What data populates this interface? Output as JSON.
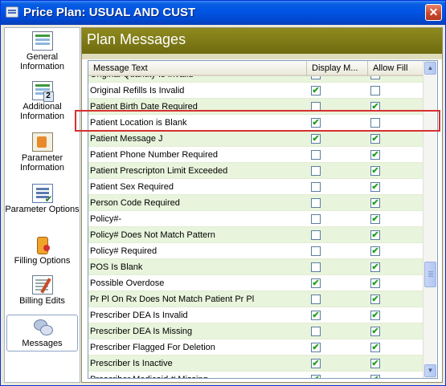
{
  "window": {
    "title": "Price Plan: USUAL AND CUST",
    "close_glyph": "✕"
  },
  "sidebar": {
    "items": [
      {
        "label": "General Information",
        "icon": "general-info-icon"
      },
      {
        "label": "Additional Information",
        "icon": "additional-info-icon"
      },
      {
        "label": "Parameter Information",
        "icon": "parameter-info-icon"
      },
      {
        "label": "Parameter Options",
        "icon": "parameter-options-icon"
      },
      {
        "label": "Filling Options",
        "icon": "filling-options-icon"
      },
      {
        "label": "Billing Edits",
        "icon": "billing-edits-icon"
      },
      {
        "label": "Messages",
        "icon": "messages-icon",
        "active": true
      }
    ]
  },
  "panel": {
    "title": "Plan Messages"
  },
  "grid": {
    "columns": [
      "Message Text",
      "Display M...",
      "Allow Fill"
    ],
    "rows": [
      {
        "text": "Original Quantity Is Invalid",
        "display": true,
        "allow": false
      },
      {
        "text": "Original Refills Is Invalid",
        "display": true,
        "allow": false
      },
      {
        "text": "Patient Birth Date Required",
        "display": false,
        "allow": true
      },
      {
        "text": "Patient Location is Blank",
        "display": true,
        "allow": false
      },
      {
        "text": "Patient Message J",
        "display": true,
        "allow": true
      },
      {
        "text": "Patient Phone Number Required",
        "display": false,
        "allow": true
      },
      {
        "text": "Patient Prescripton Limit Exceeded",
        "display": false,
        "allow": true
      },
      {
        "text": "Patient Sex Required",
        "display": false,
        "allow": true
      },
      {
        "text": "Person Code Required",
        "display": false,
        "allow": true
      },
      {
        "text": "Policy#-",
        "display": false,
        "allow": true
      },
      {
        "text": "Policy# Does Not Match Pattern",
        "display": false,
        "allow": true
      },
      {
        "text": "Policy# Required",
        "display": false,
        "allow": true
      },
      {
        "text": "POS Is Blank",
        "display": false,
        "allow": true
      },
      {
        "text": "Possible Overdose",
        "display": true,
        "allow": true
      },
      {
        "text": "Pr Pl On Rx Does Not Match Patient Pr Pl",
        "display": false,
        "allow": true
      },
      {
        "text": "Prescriber DEA Is Invalid",
        "display": true,
        "allow": true
      },
      {
        "text": "Prescriber DEA Is Missing",
        "display": false,
        "allow": true
      },
      {
        "text": "Prescriber Flagged For Deletion",
        "display": true,
        "allow": true
      },
      {
        "text": "Prescriber Is Inactive",
        "display": true,
        "allow": true
      },
      {
        "text": "Prescriber Medicaid # Missing",
        "display": true,
        "allow": true
      }
    ],
    "highlighted_row": "Patient Location is Blank"
  },
  "scrollbar": {
    "up_glyph": "▲",
    "down_glyph": "▼"
  },
  "colors": {
    "title_bar": "#0055e5",
    "panel_header": "#7c7916",
    "row_alt": "#e8f4dc",
    "check": "#21a121",
    "highlight": "#d83030"
  }
}
